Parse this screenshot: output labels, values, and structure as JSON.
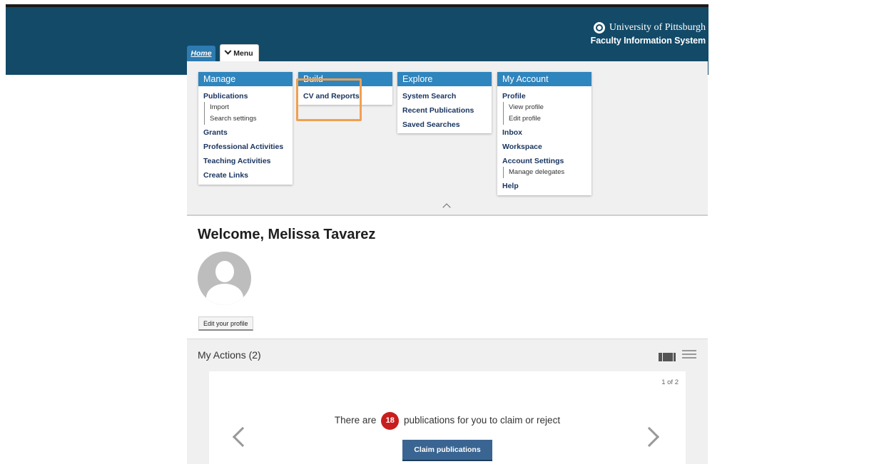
{
  "header": {
    "university": "University of Pittsburgh",
    "system_name": "Faculty Information System",
    "color": "#124a68"
  },
  "tabs": {
    "home": "Home",
    "menu": "Menu"
  },
  "menu": {
    "manage": {
      "title": "Manage",
      "items": {
        "publications": "Publications",
        "import": "Import",
        "search_settings": "Search settings",
        "grants": "Grants",
        "professional_activities": "Professional Activities",
        "teaching_activities": "Teaching Activities",
        "create_links": "Create Links"
      }
    },
    "build": {
      "title": "Build",
      "items": {
        "cv_reports": "CV and Reports"
      }
    },
    "explore": {
      "title": "Explore",
      "items": {
        "system_search": "System Search",
        "recent_publications": "Recent Publications",
        "saved_searches": "Saved Searches"
      }
    },
    "account": {
      "title": "My Account",
      "items": {
        "profile": "Profile",
        "view_profile": "View profile",
        "edit_profile": "Edit profile",
        "inbox": "Inbox",
        "workspace": "Workspace",
        "account_settings": "Account Settings",
        "manage_delegates": "Manage delegates",
        "help": "Help"
      }
    },
    "accent": "#2f85bd"
  },
  "welcome": {
    "title": "Welcome, Melissa Tavarez",
    "edit_profile_button": "Edit your profile"
  },
  "actions": {
    "title": "My Actions (2)",
    "pager": "1 of 2",
    "text_before": "There are",
    "count": "18",
    "text_after": "publications for you to claim or reject",
    "claim_button": "Claim publications",
    "badge_color": "#c81e1e"
  },
  "highlight_color": "#f0a050"
}
